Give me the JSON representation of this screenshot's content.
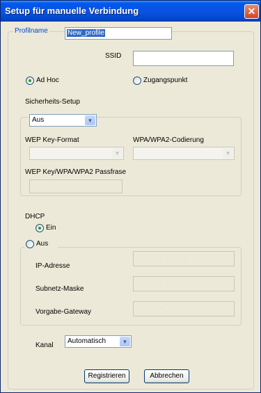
{
  "window": {
    "title": "Setup für manuelle Verbindung",
    "close_glyph": "✕"
  },
  "profile": {
    "group_label": "Profilname",
    "value": "New_profile"
  },
  "ssid": {
    "label": "SSID",
    "value": ""
  },
  "mode": {
    "adhoc_label": "Ad Hoc",
    "adhoc_checked": true,
    "ap_label": "Zugangspunkt",
    "ap_checked": false
  },
  "security": {
    "label": "Sicherheits-Setup",
    "selected": "Aus",
    "wep_format_label": "WEP Key-Format",
    "wep_format_value": "",
    "wpa_encoding_label": "WPA/WPA2-Codierung",
    "wpa_encoding_value": "",
    "passphrase_label": "WEP Key/WPA/WPA2 Passfrase",
    "passphrase_value": ""
  },
  "dhcp": {
    "label": "DHCP",
    "on_label": "Ein",
    "on_checked": true,
    "off_label": "Aus",
    "off_checked": false,
    "ip_label": "IP-Adresse",
    "subnet_label": "Subnetz-Maske",
    "gateway_label": "Vorgabe-Gateway"
  },
  "channel": {
    "label": "Kanal",
    "selected": "Automatisch"
  },
  "buttons": {
    "register": "Registrieren",
    "cancel": "Abbrechen"
  },
  "icons": {
    "dropdown": "chevron-down-icon",
    "close": "close-icon"
  },
  "colors": {
    "titlebar": "#0058ee",
    "window_bg": "#ece9d8",
    "close_button": "#d9411f",
    "selection": "#316ac5"
  }
}
